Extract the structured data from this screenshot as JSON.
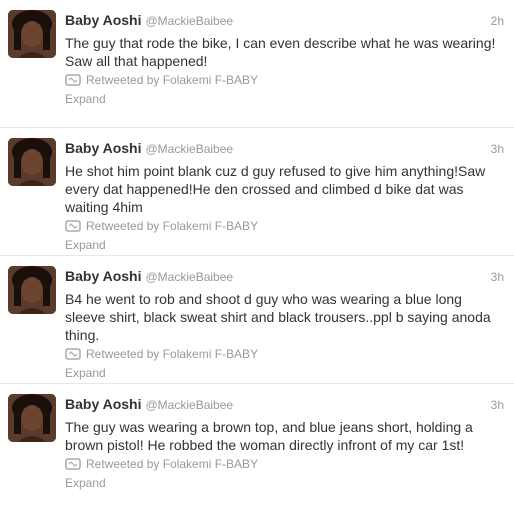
{
  "tweets": [
    {
      "name": "Baby Aoshi",
      "handle": "@MackieBaibee",
      "time": "2h",
      "text": "The guy that rode the bike, I can even describe what he was wearing! Saw all that happened!",
      "retweeted_by": "Retweeted by Folakemi F-BABY",
      "expand": "Expand"
    },
    {
      "name": "Baby Aoshi",
      "handle": "@MackieBaibee",
      "time": "3h",
      "text": "He shot him point blank cuz d guy refused to give him anything!Saw every dat happened!He den crossed and climbed d bike dat was waiting 4him",
      "retweeted_by": "Retweeted by Folakemi F-BABY",
      "expand": "Expand"
    },
    {
      "name": "Baby Aoshi",
      "handle": "@MackieBaibee",
      "time": "3h",
      "text": "B4 he went to rob and shoot d guy who was wearing a blue long sleeve shirt, black sweat shirt and black trousers..ppl b saying anoda thing.",
      "retweeted_by": "Retweeted by Folakemi F-BABY",
      "expand": "Expand"
    },
    {
      "name": "Baby Aoshi",
      "handle": "@MackieBaibee",
      "time": "3h",
      "text": "The guy was wearing a brown top, and blue jeans short, holding a brown pistol! He robbed the woman directly infront of my car 1st!",
      "retweeted_by": "Retweeted by Folakemi F-BABY",
      "expand": "Expand"
    }
  ]
}
